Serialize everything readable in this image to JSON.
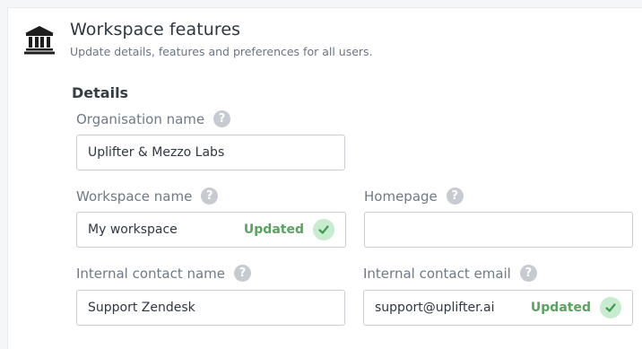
{
  "header": {
    "title": "Workspace features",
    "subtitle": "Update details, features and preferences for all users.",
    "icon": "bank-building-icon"
  },
  "details": {
    "section_title": "Details",
    "fields": {
      "organisation_name": {
        "label": "Organisation name",
        "value": "Uplifter & Mezzo Labs",
        "status": ""
      },
      "workspace_name": {
        "label": "Workspace name",
        "value": "My workspace",
        "status": "Updated"
      },
      "homepage": {
        "label": "Homepage",
        "value": "",
        "status": ""
      },
      "internal_contact_name": {
        "label": "Internal contact name",
        "value": "Support Zendesk",
        "status": ""
      },
      "internal_contact_email": {
        "label": "Internal contact email",
        "value": "support@uplifter.ai",
        "status": "Updated"
      }
    }
  },
  "help_icon_glyph": "?",
  "colors": {
    "success_text": "#58a35f",
    "success_bg": "#c8ecd0",
    "help_icon_bg": "#c7cbd1"
  }
}
